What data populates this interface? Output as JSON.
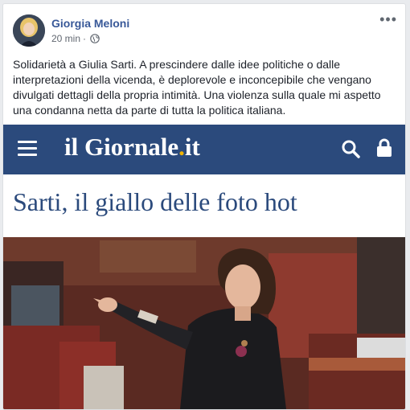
{
  "post": {
    "author": "Giorgia Meloni",
    "time": "20 min",
    "separator": "·",
    "more_label": "•••",
    "text": "Solidarietà a Giulia Sarti. A prescindere dalle idee politiche o dalle interpretazioni della vicenda, è deplorevole e inconcepibile che vengano divulgati dettagli della propria intimità. Una violenza sulla quale mi aspetto una condanna netta da parte di tutta la politica italiana."
  },
  "article": {
    "site_logo_main": "il Giornale",
    "site_logo_dot": ".",
    "site_logo_tld": "it",
    "headline": "Sarti, il giallo delle foto hot",
    "brand_color": "#2b4a7c",
    "accent_color": "#f0b400"
  },
  "icons": {
    "menu": "hamburger-icon",
    "search": "search-icon",
    "lock": "lock-icon",
    "privacy": "globe-icon"
  }
}
